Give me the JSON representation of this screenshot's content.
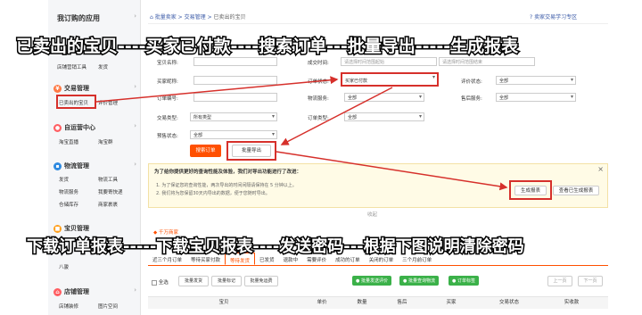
{
  "sidebar": {
    "title": "我订购的应用",
    "items_top": [
      "店铺营销工具",
      "发货"
    ],
    "sections": [
      {
        "head": "交易管理",
        "links": [
          "已卖出的宝贝",
          "评价管理"
        ]
      },
      {
        "head": "自运营中心",
        "links": [
          "淘宝直播",
          "淘宝群"
        ]
      },
      {
        "head": "物流管理",
        "links": [
          "发货",
          "物流工具",
          "物流服务",
          "我要寄快递",
          "仓储库存",
          "商家裹裹"
        ]
      },
      {
        "head": "宝贝管理",
        "links": [
          "",
          "",
          "八骏"
        ]
      },
      {
        "head": "店铺管理",
        "links": [
          "店铺装修",
          "图片空间"
        ]
      }
    ]
  },
  "breadcrumb": {
    "home": "批量卖家",
    "sep": ">",
    "level2": "交易管理",
    "level3": "已卖出的宝贝"
  },
  "top_right": "卖家交易学习专区",
  "form": {
    "item_name_label": "宝贝名称:",
    "create_time_label": "成交时间:",
    "start_placeholder": "请选择时间范围起始",
    "end_placeholder": "请选择时间范围结束",
    "buyer_label": "买家昵称:",
    "order_status_label": "订单状态:",
    "order_status_value": "买家已付款",
    "rating_label": "评价状态:",
    "rating_value": "全部",
    "order_no_label": "订单编号:",
    "logistics_label": "物流服务:",
    "logistics_value": "全部",
    "aftersale_label": "售后服务:",
    "aftersale_value": "全部",
    "trade_type_label": "交易类型:",
    "trade_type_value": "所有类型",
    "order_type_label": "订单类型:",
    "order_type_value": "全部",
    "presale_label": "预售状态:",
    "presale_value": "全部",
    "search_btn": "搜索订单",
    "export_btn": "批量导出"
  },
  "notice": {
    "title": "为了给你提供更好的查询性能及体验，我们对导出功能进行了改进：",
    "line1": "1. 为了保证您的查询性能，两次导出的时间间隔请保持在 5 分钟以上。",
    "line2": "2. 我们将为您保留30天内导出的数据，便于您随时导出。",
    "gen_btn": "生成报表",
    "view_btn": "查看已生成报表",
    "close": "×"
  },
  "collapse": "收起",
  "tips": "千万商家",
  "tabs": [
    "近三个月订单",
    "等待买家付款",
    "等待发货",
    "已发货",
    "退款中",
    "需要评价",
    "成功的订单",
    "关闭的订单",
    "三个月前订单"
  ],
  "active_tab": 2,
  "toolbar": {
    "select_all": "全选",
    "batch_ship": "批量发货",
    "batch_mark": "批量标记",
    "batch_free": "批量免运费",
    "green1": "批量发送评价",
    "green2": "批量查询物流",
    "green3": "订单标签",
    "prev": "上一页",
    "next": "下一页"
  },
  "table_headers": [
    "宝贝",
    "单价",
    "数量",
    "售后",
    "买家",
    "交易状态",
    "实收款"
  ],
  "overlays": {
    "top": "已卖出的宝贝----买家已付款----搜索订单---批量导出-----生成报表",
    "bottom": "下载订单报表-----下载宝贝报表----发送密码---根据下图说明清除密码"
  },
  "colors": {
    "accent": "#ff5000",
    "highlight": "#d6302b",
    "link": "#3c5ba8"
  }
}
